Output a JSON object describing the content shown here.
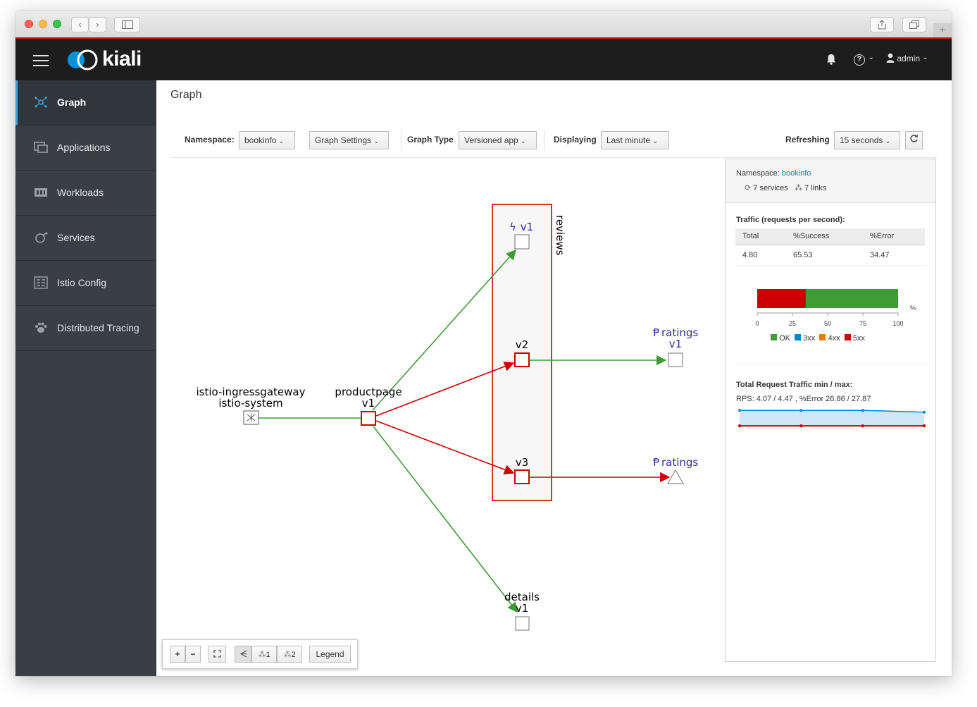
{
  "browser": {
    "nav_back": "‹",
    "nav_forward": "›"
  },
  "masthead": {
    "brand": "kiali",
    "help_icon": "?",
    "user": "admin"
  },
  "sidebar": {
    "items": [
      {
        "label": "Graph",
        "icon": "graph-icon",
        "active": true
      },
      {
        "label": "Applications",
        "icon": "applications-icon",
        "active": false
      },
      {
        "label": "Workloads",
        "icon": "workloads-icon",
        "active": false
      },
      {
        "label": "Services",
        "icon": "services-icon",
        "active": false
      },
      {
        "label": "Istio Config",
        "icon": "istio-config-icon",
        "active": false
      },
      {
        "label": "Distributed Tracing",
        "icon": "tracing-icon",
        "active": false
      }
    ]
  },
  "page": {
    "title": "Graph"
  },
  "toolbar": {
    "namespace_label": "Namespace:",
    "namespace_value": "bookinfo",
    "graph_settings": "Graph Settings",
    "graph_type_label": "Graph Type",
    "graph_type_value": "Versioned app",
    "displaying_label": "Displaying",
    "displaying_value": "Last minute",
    "refreshing_label": "Refreshing",
    "refreshing_value": "15 seconds"
  },
  "graph": {
    "nodes": {
      "gateway_name": "istio-ingressgateway",
      "gateway_ns": "istio-system",
      "productpage": "productpage",
      "productpage_version": "v1",
      "reviews_group": "reviews",
      "reviews_v1": "v1",
      "reviews_v2": "v2",
      "reviews_v3": "v3",
      "ratings_v1_name": "ratings",
      "ratings_v1_version": "v1",
      "ratings_unknown": "ratings",
      "details": "details",
      "details_version": "v1"
    },
    "controls": {
      "zoom_in": "+",
      "zoom_out": "−",
      "layout_1": "1",
      "layout_2": "2",
      "legend": "Legend"
    },
    "colors": {
      "ok": "#3f9c35",
      "error": "#cc0000",
      "unknown_label": "#2d2ba3"
    }
  },
  "panel": {
    "namespace_label": "Namespace:",
    "namespace_value": "bookinfo",
    "services": "7 services",
    "links": "7 links",
    "traffic_title": "Traffic (requests per second):",
    "table": {
      "headers": [
        "Total",
        "%Success",
        "%Error"
      ],
      "row": [
        "4.80",
        "65.53",
        "34.47"
      ]
    },
    "bar": {
      "error_pct": 34.47,
      "success_pct": 65.53,
      "unit": "%",
      "ticks": [
        "0",
        "25",
        "50",
        "75",
        "100"
      ],
      "legend": [
        {
          "label": "OK",
          "color": "#3f9c35"
        },
        {
          "label": "3xx",
          "color": "#0088ce"
        },
        {
          "label": "4xx",
          "color": "#ec7a08"
        },
        {
          "label": "5xx",
          "color": "#cc0000"
        }
      ]
    },
    "total_traffic_title": "Total Request Traffic min / max:",
    "total_traffic_text": "RPS: 4.07 / 4.47 , %Error 26.86 / 27.87",
    "sparkline": {
      "rps": [
        4.47,
        4.46,
        4.47,
        4.07
      ],
      "error": [
        27.87,
        27.87,
        27.86,
        27.87
      ]
    }
  }
}
